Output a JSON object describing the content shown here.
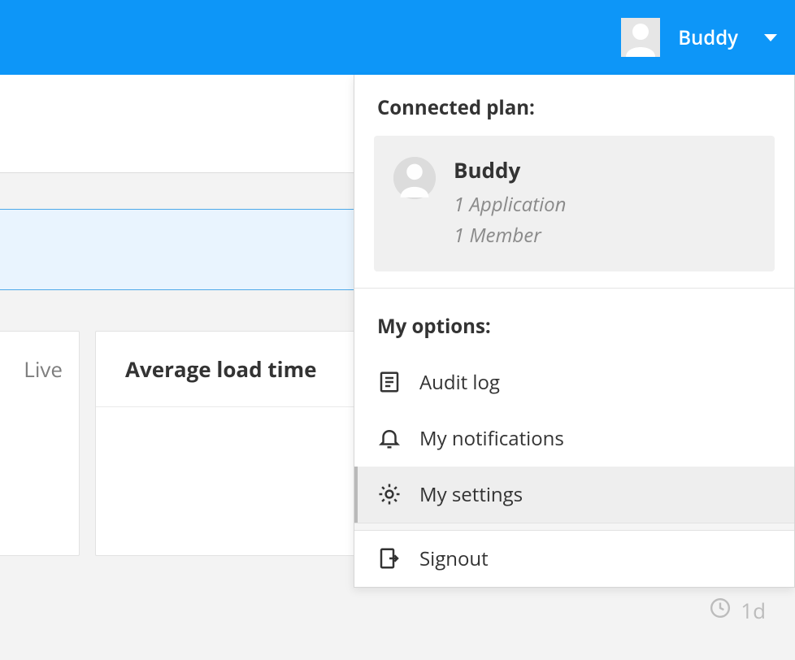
{
  "header": {
    "username": "Buddy"
  },
  "dropdown": {
    "section_plan_title": "Connected plan:",
    "plan": {
      "name": "Buddy",
      "app_count": "1 Application",
      "member_count": "1 Member"
    },
    "section_options_title": "My options:",
    "options": {
      "audit_log": "Audit log",
      "my_notifications": "My notifications",
      "my_settings": "My settings",
      "signout": "Signout"
    }
  },
  "background": {
    "live_label": "Live",
    "card_title": "Average load time",
    "time_label": "1d"
  }
}
